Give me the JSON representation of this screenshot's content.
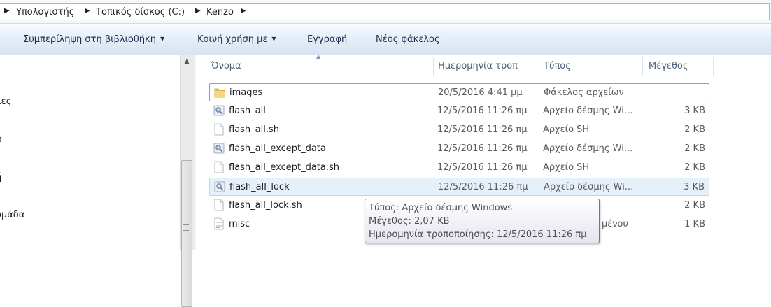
{
  "breadcrumb": {
    "items": [
      "Υπολογιστής",
      "Τοπικός δίσκος (C:)",
      "Kenzo"
    ]
  },
  "toolbar": {
    "include_library": "Συμπερίληψη στη βιβλιοθήκη",
    "share_with": "Κοινή χρήση με",
    "burn": "Εγγραφή",
    "new_folder": "Νέος φάκελος"
  },
  "nav": {
    "items": [
      "κες",
      "α",
      "ή",
      "ομάδα"
    ]
  },
  "columns": {
    "name": "Όνομα",
    "date": "Ημερομηνία τροπ",
    "type": "Τύπος",
    "size": "Μέγεθος"
  },
  "files": [
    {
      "name": "images",
      "date": "20/5/2016 4:41 μμ",
      "type": "Φάκελος αρχείων",
      "size": "",
      "icon": "folder-icon"
    },
    {
      "name": "flash_all",
      "date": "12/5/2016 11:26 πμ",
      "type": "Αρχείο δέσμης Wi...",
      "size": "3 KB",
      "icon": "batch-file-icon"
    },
    {
      "name": "flash_all.sh",
      "date": "12/5/2016 11:26 πμ",
      "type": "Αρχείο SH",
      "size": "2 KB",
      "icon": "file-icon"
    },
    {
      "name": "flash_all_except_data",
      "date": "12/5/2016 11:26 πμ",
      "type": "Αρχείο δέσμης Wi...",
      "size": "2 KB",
      "icon": "batch-file-icon"
    },
    {
      "name": "flash_all_except_data.sh",
      "date": "12/5/2016 11:26 πμ",
      "type": "Αρχείο SH",
      "size": "2 KB",
      "icon": "file-icon"
    },
    {
      "name": "flash_all_lock",
      "date": "12/5/2016 11:26 πμ",
      "type": "Αρχείο δέσμης Wi...",
      "size": "3 KB",
      "icon": "batch-file-icon"
    },
    {
      "name": "flash_all_lock.sh",
      "date": "",
      "type": "",
      "size": "2 KB",
      "icon": "file-icon"
    },
    {
      "name": "misc",
      "date": "",
      "type": "μένου",
      "size": "1 KB",
      "icon": "text-file-icon"
    }
  ],
  "tooltip": {
    "type_line": "Τύπος: Αρχείο δέσμης Windows",
    "size_line": "Μέγεθος: 2,07 KB",
    "date_line": "Ημερομηνία τροποποίησης: 12/5/2016 11:26 πμ"
  }
}
